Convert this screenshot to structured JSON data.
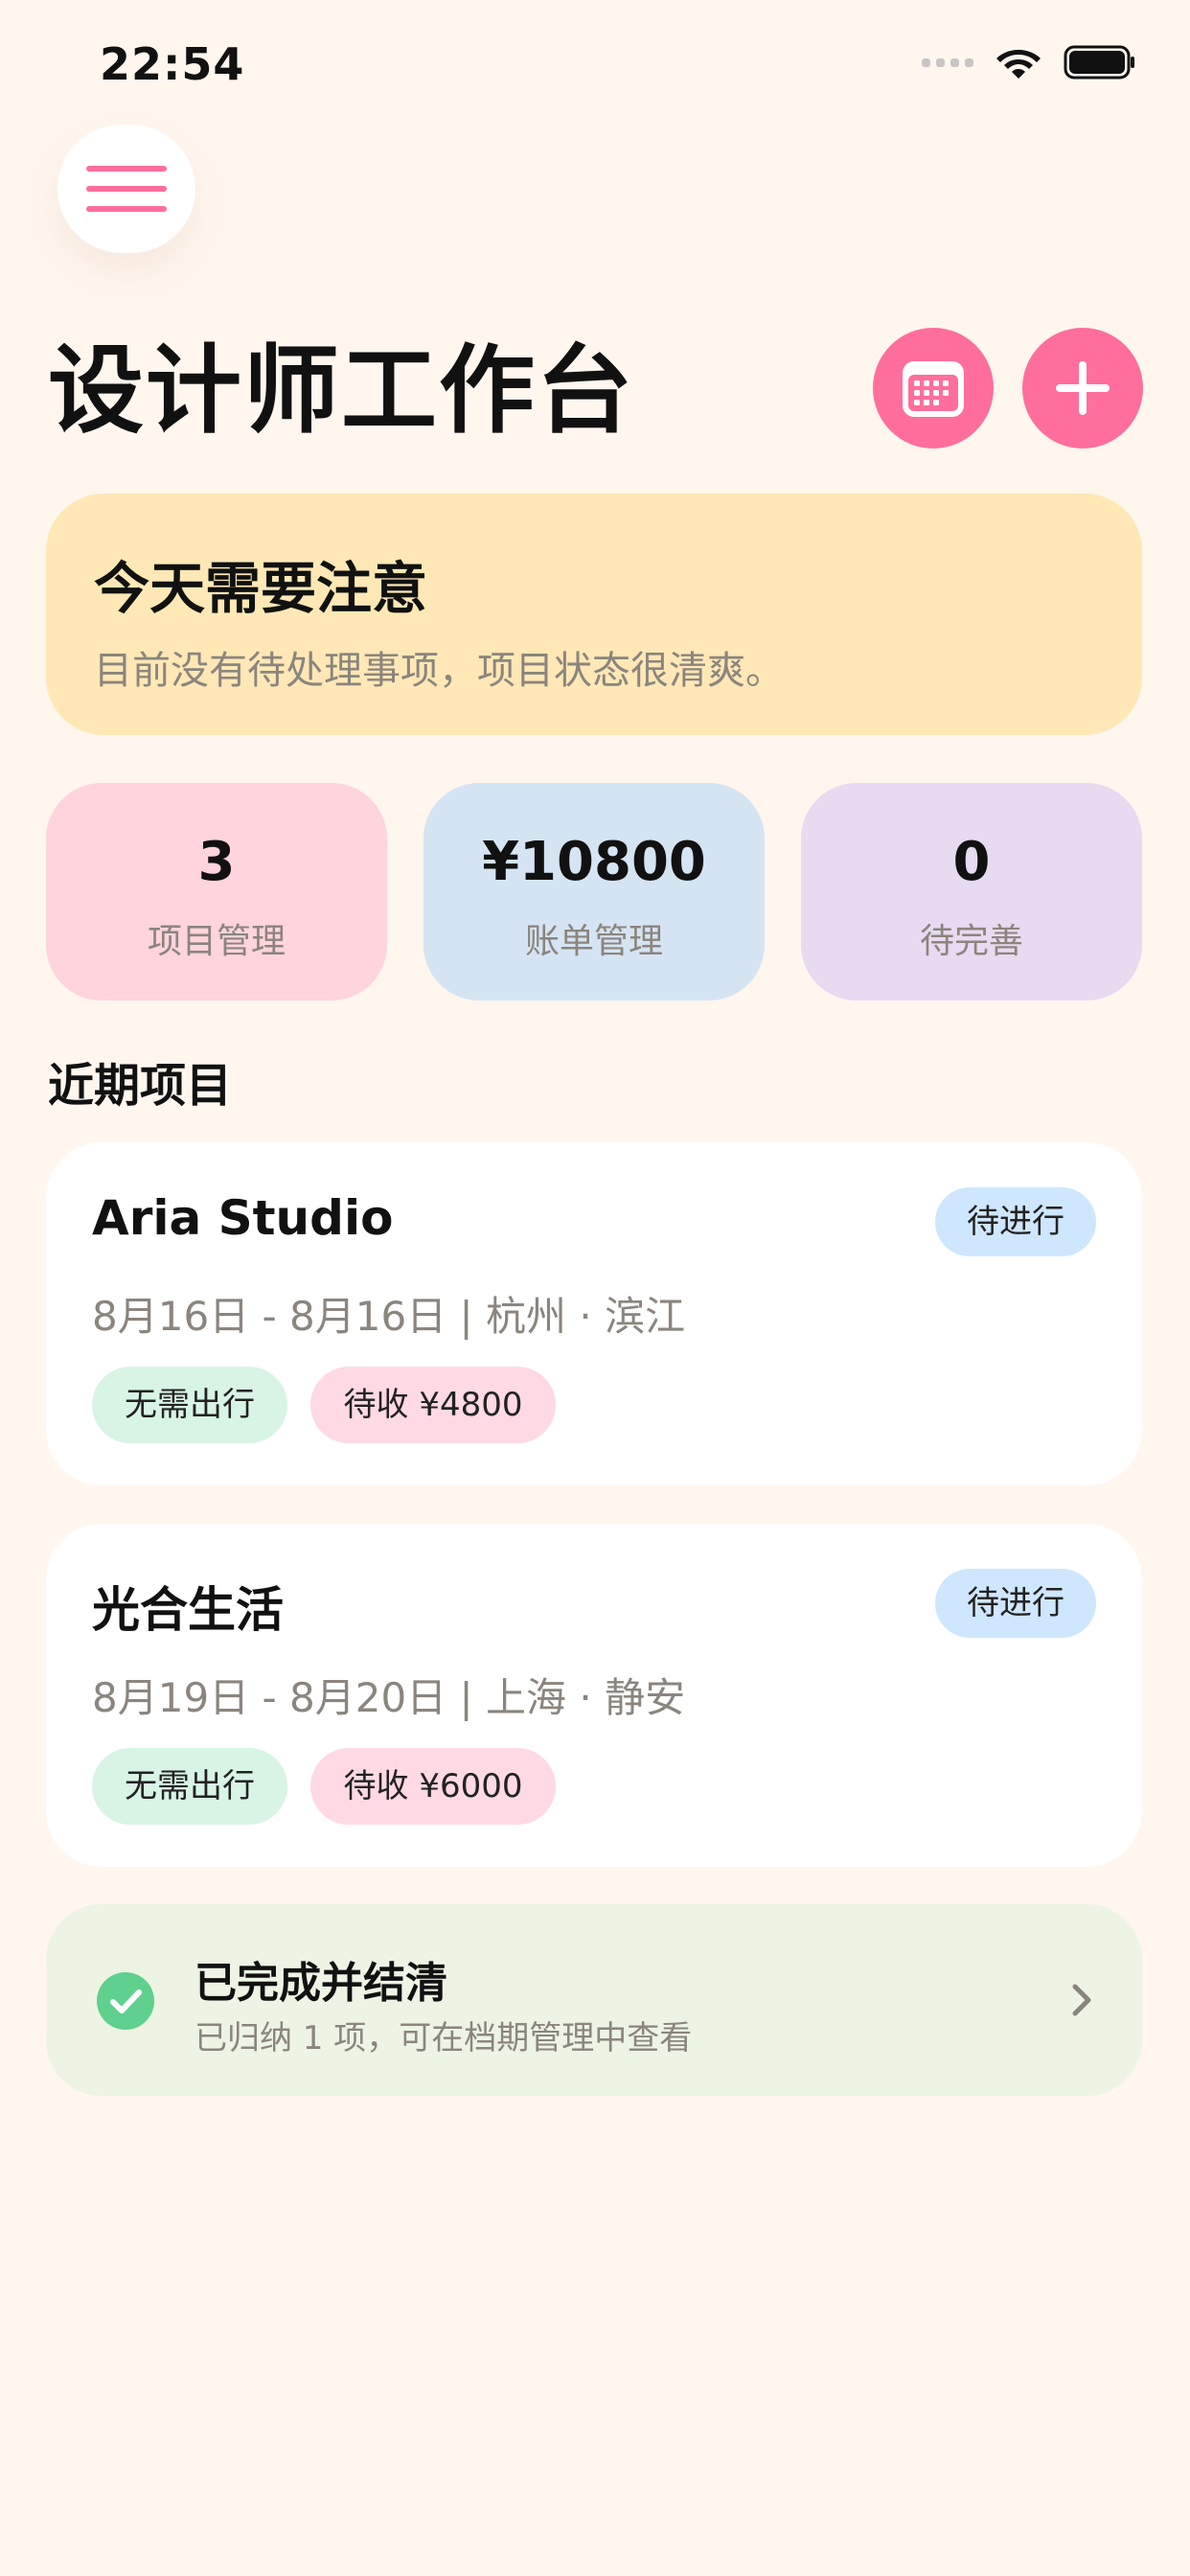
{
  "status_bar": {
    "time": "22:54"
  },
  "header": {
    "title": "设计师工作台"
  },
  "notice": {
    "title": "今天需要注意",
    "subtitle": "目前没有待处理事项，项目状态很清爽。"
  },
  "stats": [
    {
      "value": "3",
      "label": "项目管理"
    },
    {
      "value": "¥10800",
      "label": "账单管理"
    },
    {
      "value": "0",
      "label": "待完善"
    }
  ],
  "recent": {
    "title": "近期项目",
    "projects": [
      {
        "name": "Aria Studio",
        "status": "待进行",
        "meta": "8月16日 - 8月16日 | 杭州 · 滨江",
        "travel_tag": "无需出行",
        "due_tag": "待收 ¥4800"
      },
      {
        "name": "光合生活",
        "status": "待进行",
        "meta": "8月19日 - 8月20日 | 上海 · 静安",
        "travel_tag": "无需出行",
        "due_tag": "待收 ¥6000"
      }
    ]
  },
  "completed": {
    "title": "已完成并结清",
    "subtitle": "已归纳 1 项，可在档期管理中查看"
  },
  "colors": {
    "background": "#FFF6EE",
    "accent": "#FF6E9C",
    "notice_bg": "#FFE8B5",
    "check_green": "#5FD08E"
  },
  "icons": {
    "menu": "hamburger-icon",
    "calendar": "calendar-icon",
    "add": "plus-icon",
    "check": "check-circle-icon",
    "chevron": "chevron-right-icon"
  }
}
